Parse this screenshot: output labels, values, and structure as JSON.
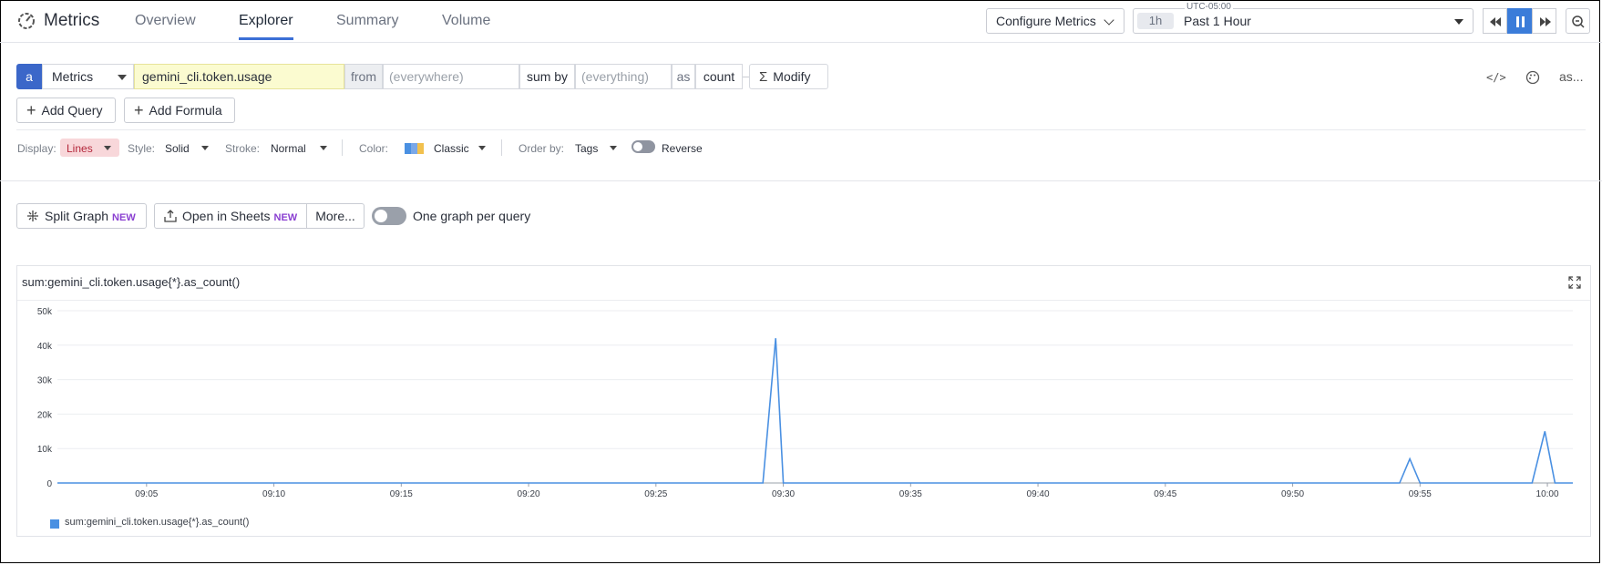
{
  "app": {
    "title": "Metrics",
    "tabs": [
      {
        "label": "Overview",
        "active": false
      },
      {
        "label": "Explorer",
        "active": true
      },
      {
        "label": "Summary",
        "active": false
      },
      {
        "label": "Volume",
        "active": false
      }
    ],
    "configure_label": "Configure Metrics",
    "timezone": "UTC-05:00",
    "time_badge": "1h",
    "time_label": "Past 1 Hour"
  },
  "query": {
    "letter": "a",
    "source": "Metrics",
    "metric": "gemini_cli.token.usage",
    "from_label": "from",
    "from_placeholder": "(everywhere)",
    "sum_by_label": "sum by",
    "sum_by_placeholder": "(everything)",
    "as_label": "as",
    "as_value": "count",
    "modify_label": "Modify",
    "right_as": "as..."
  },
  "actions": {
    "add_query": "Add Query",
    "add_formula": "Add Formula"
  },
  "display": {
    "display_label": "Display:",
    "display_value": "Lines",
    "style_label": "Style:",
    "style_value": "Solid",
    "stroke_label": "Stroke:",
    "stroke_value": "Normal",
    "color_label": "Color:",
    "color_value": "Classic",
    "order_label": "Order by:",
    "order_value": "Tags",
    "reverse_label": "Reverse",
    "palette_colors": [
      "#4a90e2",
      "#7aa8e8",
      "#f2c14e"
    ]
  },
  "graph_actions": {
    "split_graph": "Split Graph",
    "new_badge": "NEW",
    "open_in_sheets": "Open in Sheets",
    "more": "More...",
    "one_graph_per_query": "One graph per query",
    "one_graph_enabled": false
  },
  "chart_data": {
    "type": "line",
    "title": "sum:gemini_cli.token.usage{*}.as_count()",
    "x_ticks": [
      "09:05",
      "09:10",
      "09:15",
      "09:20",
      "09:25",
      "09:30",
      "09:35",
      "09:40",
      "09:45",
      "09:50",
      "09:55",
      "10:00"
    ],
    "y_ticks": [
      "0",
      "10k",
      "20k",
      "30k",
      "40k",
      "50k"
    ],
    "ylim": [
      0,
      50000
    ],
    "xlim_minutes": [
      1.5,
      61.0
    ],
    "grid": true,
    "legend_position": "bottom-left",
    "series": [
      {
        "name": "sum:gemini_cli.token.usage{*}.as_count()",
        "color": "#4a90e2",
        "x_minutes": [
          1.5,
          29.2,
          29.7,
          30.0,
          54.2,
          54.6,
          55.0,
          59.4,
          59.9,
          60.3,
          61.0
        ],
        "values": [
          0,
          0,
          42000,
          0,
          0,
          7000,
          0,
          0,
          15000,
          0,
          0
        ]
      }
    ]
  }
}
